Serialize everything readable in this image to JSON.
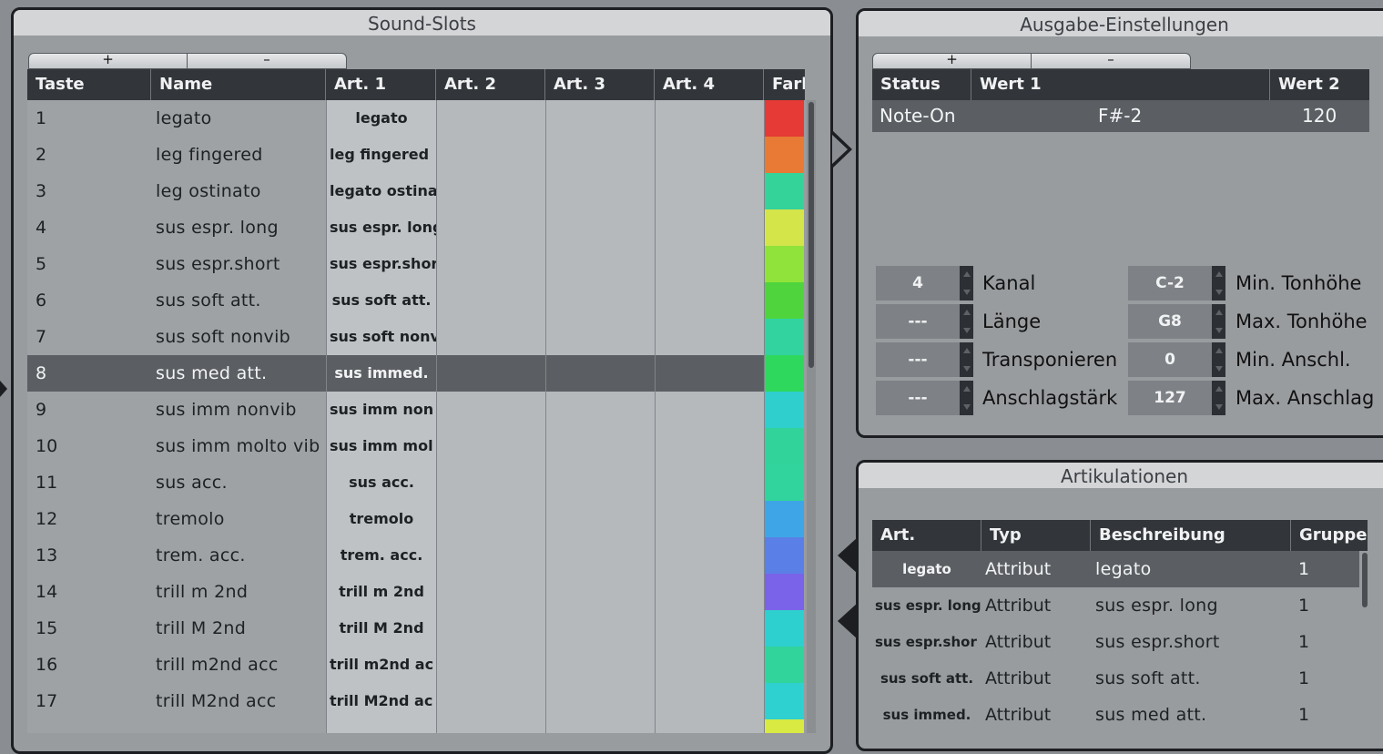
{
  "sound_slots": {
    "title": "Sound-Slots",
    "add_label": "+",
    "remove_label": "–",
    "columns": [
      "Taste",
      "Name",
      "Art. 1",
      "Art. 2",
      "Art. 3",
      "Art. 4",
      "Farb"
    ],
    "rows": [
      {
        "key": "1",
        "name": "legato",
        "art1": "legato",
        "color": "#e53a35"
      },
      {
        "key": "2",
        "name": "leg fingered",
        "art1": "leg fingered",
        "color": "#e87a35"
      },
      {
        "key": "3",
        "name": "leg ostinato",
        "art1": "legato ostina",
        "color": "#33d39a"
      },
      {
        "key": "4",
        "name": "sus espr. long",
        "art1": "sus espr. long",
        "color": "#d4e54a"
      },
      {
        "key": "5",
        "name": "sus espr.short",
        "art1": "sus espr.shor",
        "color": "#8fe33a"
      },
      {
        "key": "6",
        "name": "sus soft att.",
        "art1": "sus soft att.",
        "color": "#4fd43d"
      },
      {
        "key": "7",
        "name": "sus soft nonvib",
        "art1": "sus soft nonv",
        "color": "#32d39e"
      },
      {
        "key": "8",
        "name": "sus med att.",
        "art1": "sus immed.",
        "color": "#2ed85d"
      },
      {
        "key": "9",
        "name": "sus imm nonvib",
        "art1": "sus imm non",
        "color": "#2ecfcd"
      },
      {
        "key": "10",
        "name": "sus imm molto vib",
        "art1": "sus imm mol",
        "color": "#31d39b"
      },
      {
        "key": "11",
        "name": "sus acc.",
        "art1": "sus acc.",
        "color": "#30d49c"
      },
      {
        "key": "12",
        "name": "tremolo",
        "art1": "tremolo",
        "color": "#3ea5e6"
      },
      {
        "key": "13",
        "name": "trem. acc.",
        "art1": "trem. acc.",
        "color": "#5a80e8"
      },
      {
        "key": "14",
        "name": "trill m 2nd",
        "art1": "trill m 2nd",
        "color": "#7a63e8"
      },
      {
        "key": "15",
        "name": "trill M 2nd",
        "art1": "trill M 2nd",
        "color": "#2ecfcf"
      },
      {
        "key": "16",
        "name": "trill m2nd acc",
        "art1": "trill m2nd ac",
        "color": "#31d49b"
      },
      {
        "key": "17",
        "name": "trill M2nd acc",
        "art1": "trill M2nd ac",
        "color": "#2ed0d0"
      },
      {
        "key": "",
        "name": "",
        "art1": "",
        "color": "#d9ea42"
      }
    ],
    "selected_key": "8"
  },
  "output": {
    "title": "Ausgabe-Einstellungen",
    "add_label": "+",
    "remove_label": "–",
    "columns": [
      "Status",
      "Wert 1",
      "Wert 2"
    ],
    "rows": [
      {
        "status": "Note-On",
        "value1": "F#-2",
        "value2": "120"
      }
    ],
    "fields_left": [
      {
        "value": "4",
        "label": "Kanal"
      },
      {
        "value": "---",
        "label": "Länge"
      },
      {
        "value": "---",
        "label": "Transponieren"
      },
      {
        "value": "---",
        "label": "Anschlagstärk"
      }
    ],
    "fields_right": [
      {
        "value": "C-2",
        "label": "Min. Tonhöhe"
      },
      {
        "value": "G8",
        "label": "Max. Tonhöhe"
      },
      {
        "value": "0",
        "label": "Min. Anschl."
      },
      {
        "value": "127",
        "label": "Max. Anschlag"
      }
    ]
  },
  "articulations": {
    "title": "Artikulationen",
    "columns": [
      "Art.",
      "Typ",
      "Beschreibung",
      "Gruppe"
    ],
    "rows": [
      {
        "art": "legato",
        "type": "Attribut",
        "desc": "legato",
        "group": "1"
      },
      {
        "art": "sus espr. long",
        "type": "Attribut",
        "desc": "sus espr. long",
        "group": "1"
      },
      {
        "art": "sus espr.shor",
        "type": "Attribut",
        "desc": "sus espr.short",
        "group": "1"
      },
      {
        "art": "sus soft att.",
        "type": "Attribut",
        "desc": "sus soft att.",
        "group": "1"
      },
      {
        "art": "sus immed.",
        "type": "Attribut",
        "desc": "sus med att.",
        "group": "1"
      }
    ]
  }
}
